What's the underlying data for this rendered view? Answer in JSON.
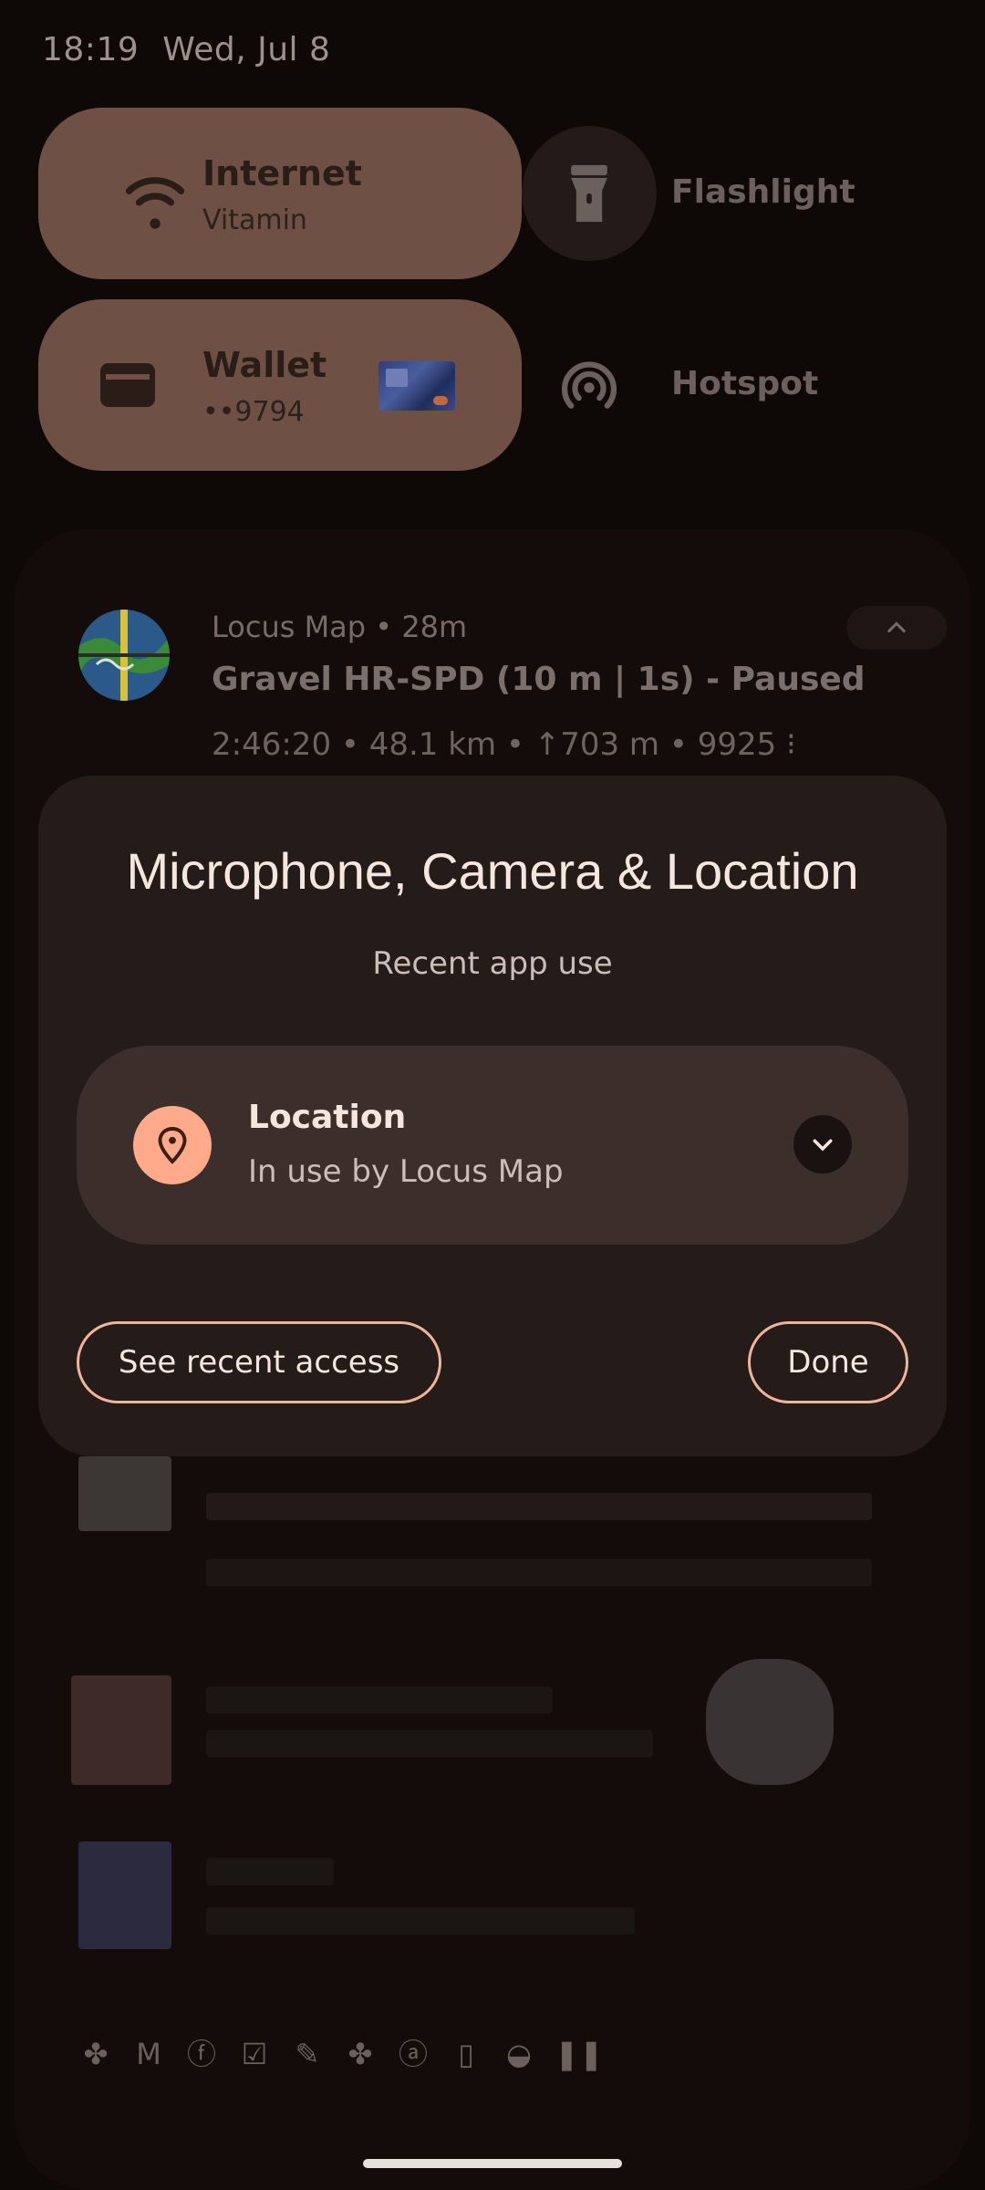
{
  "status_bar": {
    "time": "18:19",
    "date": "Wed, Jul 8"
  },
  "quick_settings": {
    "internet": {
      "label": "Internet",
      "sublabel": "Vitamin",
      "icon": "wifi-icon"
    },
    "flashlight": {
      "label": "Flashlight",
      "icon": "flashlight-icon"
    },
    "wallet": {
      "label": "Wallet",
      "sublabel": "••9794",
      "icon": "wallet-icon"
    },
    "hotspot": {
      "label": "Hotspot",
      "icon": "hotspot-icon"
    }
  },
  "notification": {
    "app": "Locus Map • 28m",
    "title": "Gravel HR-SPD (10 m | 1s) - Paused",
    "stats": "2:46:20 • 48.1 km • ↑703 m • 9925 ⁝"
  },
  "dialog": {
    "title": "Microphone, Camera & Location",
    "subtitle": "Recent app use",
    "item": {
      "title": "Location",
      "subtitle": "In use by Locus Map",
      "icon": "location-pin-icon"
    },
    "see_recent_label": "See recent access",
    "done_label": "Done"
  },
  "colors": {
    "accent": "#ffaa8a",
    "tile": "#6e5045",
    "dialog": "#251b18"
  }
}
